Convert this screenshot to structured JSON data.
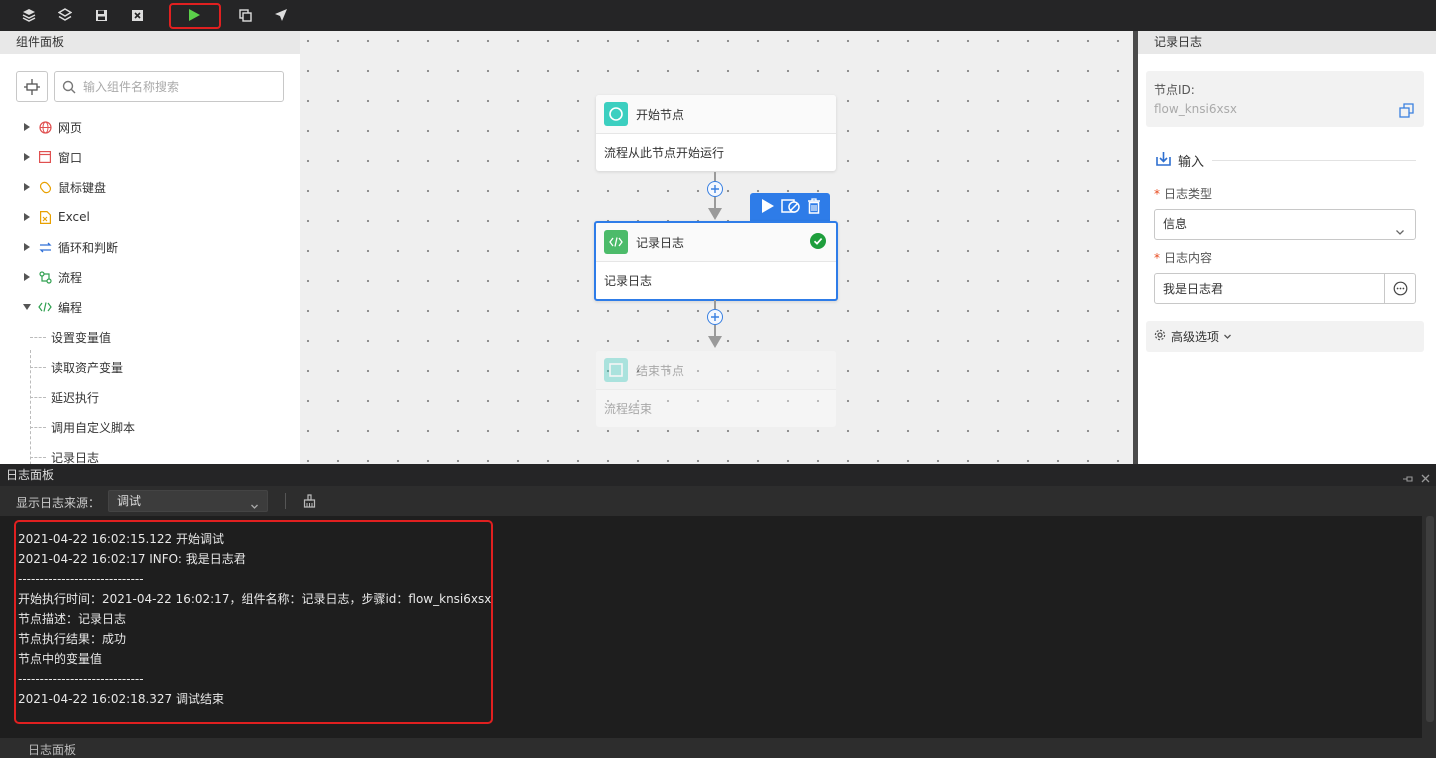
{
  "toolbar": {
    "buttons": [
      "layers-icon",
      "layers-alt-icon",
      "save-icon",
      "close-box-icon",
      "run-icon",
      "copy-window-icon",
      "send-icon"
    ]
  },
  "left_panel": {
    "title": "组件面板",
    "search_placeholder": "输入组件名称搜索",
    "categories": [
      {
        "label": "网页",
        "icon": "globe-icon",
        "color": "#e05050"
      },
      {
        "label": "窗口",
        "icon": "window-icon",
        "color": "#e05050"
      },
      {
        "label": "鼠标键盘",
        "icon": "mouse-icon",
        "color": "#e8a000"
      },
      {
        "label": "Excel",
        "icon": "excel-icon",
        "color": "#e8a000"
      },
      {
        "label": "循环和判断",
        "icon": "loop-icon",
        "color": "#3070d8"
      },
      {
        "label": "流程",
        "icon": "flow-icon",
        "color": "#30a050"
      },
      {
        "label": "编程",
        "icon": "code-icon",
        "color": "#30a050"
      }
    ],
    "sub_items": [
      "设置变量值",
      "读取资产变量",
      "延迟执行",
      "调用自定义脚本",
      "记录日志"
    ]
  },
  "canvas": {
    "start_node": {
      "title": "开始节点",
      "desc": "流程从此节点开始运行"
    },
    "log_node": {
      "title": "记录日志",
      "desc": "记录日志",
      "status": "success"
    },
    "end_node": {
      "title": "结束节点",
      "desc": "流程结束"
    }
  },
  "right_panel": {
    "title": "记录日志",
    "node_id_label": "节点ID:",
    "node_id_value": "flow_knsi6xsx",
    "section_input": "输入",
    "log_type_label": "日志类型",
    "log_type_value": "信息",
    "log_content_label": "日志内容",
    "log_content_value": "我是日志君",
    "advanced_label": "高级选项"
  },
  "log_panel": {
    "title": "日志面板",
    "source_label": "显示日志来源：",
    "source_value": "调试",
    "lines": [
      "2021-04-22 16:02:15.122 开始调试",
      "2021-04-22 16:02:17 INFO: 我是日志君",
      "-----------------------------",
      "开始执行时间：2021-04-22 16:02:17，组件名称：记录日志，步骤id：flow_knsi6xsx",
      "节点描述：记录日志",
      "节点执行结果：成功",
      "节点中的变量值",
      "-----------------------------",
      "2021-04-22 16:02:18.327 调试结束"
    ],
    "footer_tab": "日志面板"
  }
}
